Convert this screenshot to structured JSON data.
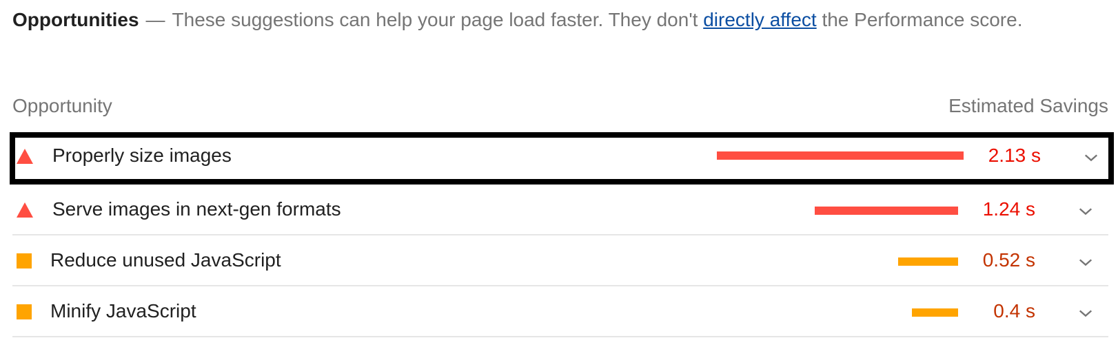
{
  "intro": {
    "title": "Opportunities",
    "separator": "—",
    "text_before": "These suggestions can help your page load faster. They don't ",
    "link": "directly affect",
    "text_after": " the Performance score."
  },
  "columns": {
    "opportunity": "Opportunity",
    "savings": "Estimated Savings"
  },
  "colors": {
    "fail": "#ff4e42",
    "fail_text": "#eb0f00",
    "average": "#ffa400",
    "average_text": "#c33300"
  },
  "rows": [
    {
      "label": "Properly size images",
      "value": "2.13 s",
      "icon": "triangle-warning-icon",
      "severity": "fail",
      "savings_fraction": 1.0
    },
    {
      "label": "Serve images in next-gen formats",
      "value": "1.24 s",
      "icon": "triangle-warning-icon",
      "severity": "fail",
      "savings_fraction": 0.582
    },
    {
      "label": "Reduce unused JavaScript",
      "value": "0.52 s",
      "icon": "square-warning-icon",
      "severity": "average",
      "savings_fraction": 0.244
    },
    {
      "label": "Minify JavaScript",
      "value": "0.4 s",
      "icon": "square-warning-icon",
      "severity": "average",
      "savings_fraction": 0.188
    }
  ]
}
